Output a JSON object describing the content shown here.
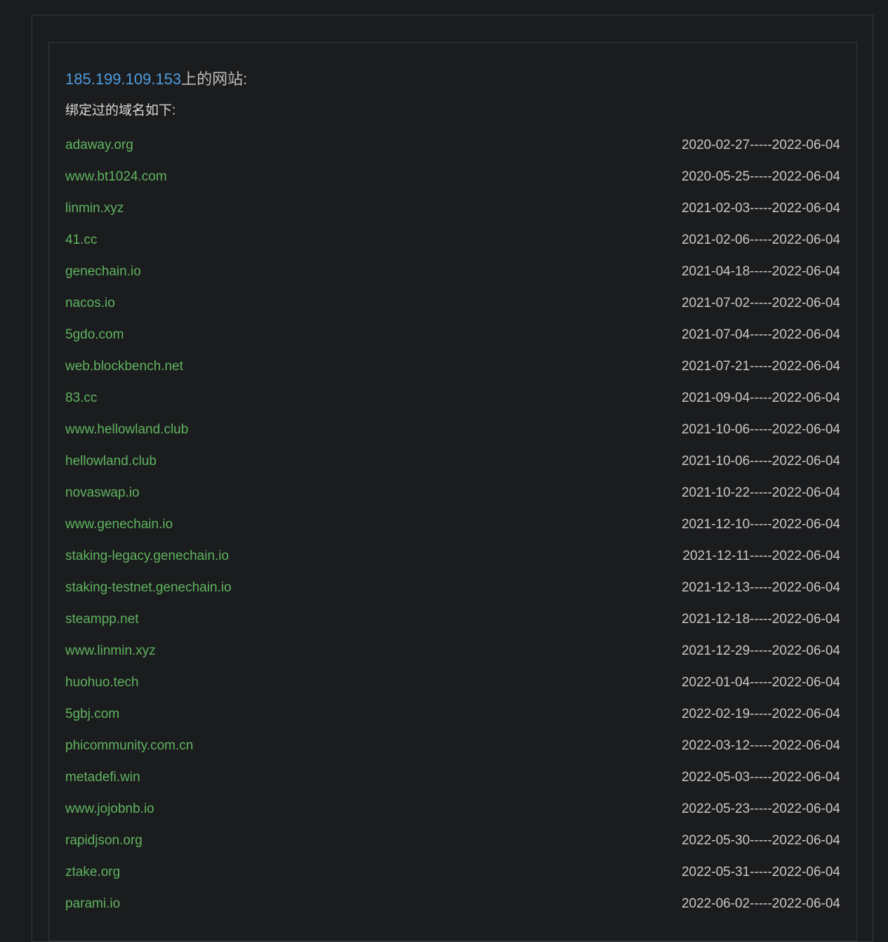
{
  "header": {
    "ip": "185.199.109.153",
    "title_suffix": "上的网站:",
    "subtitle": "绑定过的域名如下:"
  },
  "domains": [
    {
      "name": "adaway.org",
      "range": "2020-02-27-----2022-06-04"
    },
    {
      "name": "www.bt1024.com",
      "range": "2020-05-25-----2022-06-04"
    },
    {
      "name": "linmin.xyz",
      "range": "2021-02-03-----2022-06-04"
    },
    {
      "name": "41.cc",
      "range": "2021-02-06-----2022-06-04"
    },
    {
      "name": "genechain.io",
      "range": "2021-04-18-----2022-06-04"
    },
    {
      "name": "nacos.io",
      "range": "2021-07-02-----2022-06-04"
    },
    {
      "name": "5gdo.com",
      "range": "2021-07-04-----2022-06-04"
    },
    {
      "name": "web.blockbench.net",
      "range": "2021-07-21-----2022-06-04"
    },
    {
      "name": "83.cc",
      "range": "2021-09-04-----2022-06-04"
    },
    {
      "name": "www.hellowland.club",
      "range": "2021-10-06-----2022-06-04"
    },
    {
      "name": "hellowland.club",
      "range": "2021-10-06-----2022-06-04"
    },
    {
      "name": "novaswap.io",
      "range": "2021-10-22-----2022-06-04"
    },
    {
      "name": "www.genechain.io",
      "range": "2021-12-10-----2022-06-04"
    },
    {
      "name": "staking-legacy.genechain.io",
      "range": "2021-12-11-----2022-06-04"
    },
    {
      "name": "staking-testnet.genechain.io",
      "range": "2021-12-13-----2022-06-04"
    },
    {
      "name": "steampp.net",
      "range": "2021-12-18-----2022-06-04"
    },
    {
      "name": "www.linmin.xyz",
      "range": "2021-12-29-----2022-06-04"
    },
    {
      "name": "huohuo.tech",
      "range": "2022-01-04-----2022-06-04"
    },
    {
      "name": "5gbj.com",
      "range": "2022-02-19-----2022-06-04"
    },
    {
      "name": "phicommunity.com.cn",
      "range": "2022-03-12-----2022-06-04"
    },
    {
      "name": "metadefi.win",
      "range": "2022-05-03-----2022-06-04"
    },
    {
      "name": "www.jojobnb.io",
      "range": "2022-05-23-----2022-06-04"
    },
    {
      "name": "rapidjson.org",
      "range": "2022-05-30-----2022-06-04"
    },
    {
      "name": "ztake.org",
      "range": "2022-05-31-----2022-06-04"
    },
    {
      "name": "parami.io",
      "range": "2022-06-02-----2022-06-04"
    }
  ]
}
